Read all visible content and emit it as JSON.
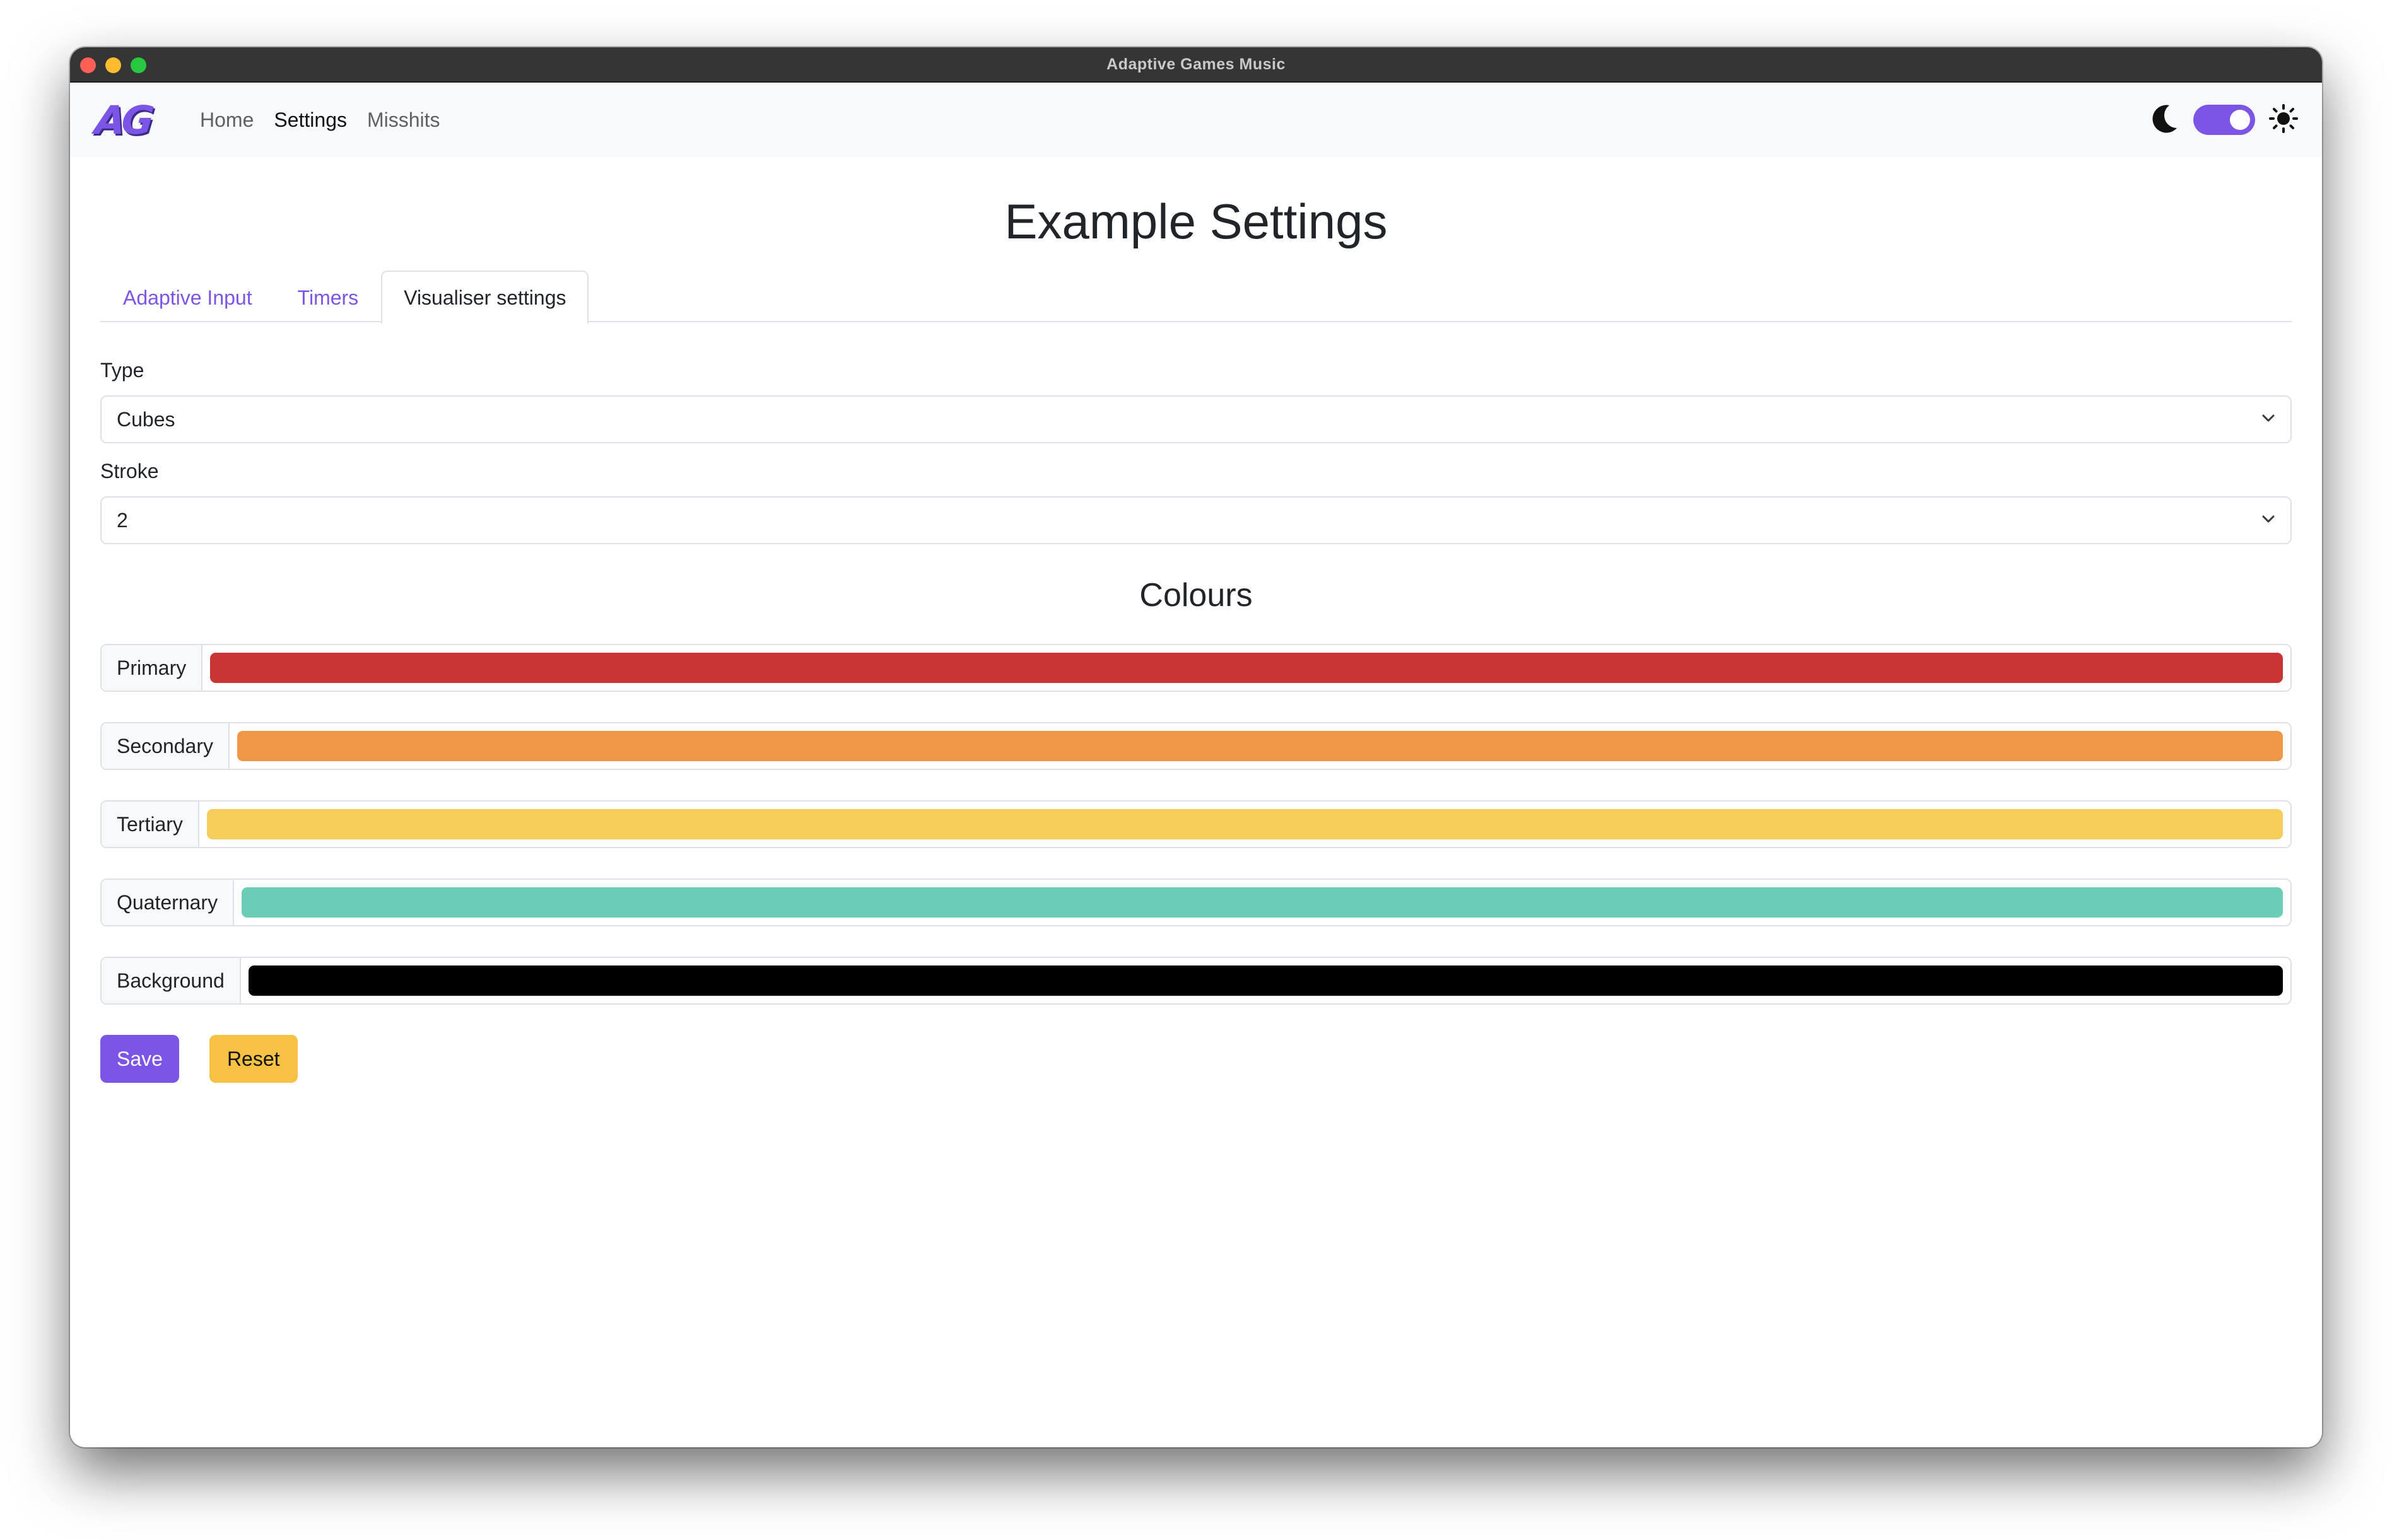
{
  "window": {
    "title": "Adaptive Games Music"
  },
  "navbar": {
    "logo_text": "AG",
    "links": [
      {
        "label": "Home",
        "active": false
      },
      {
        "label": "Settings",
        "active": true
      },
      {
        "label": "Misshits",
        "active": false
      }
    ],
    "theme_toggle": {
      "state": "on",
      "left_icon": "moon-icon",
      "right_icon": "sun-icon",
      "accent": "#7c55e6"
    }
  },
  "page": {
    "title": "Example Settings",
    "tabs": [
      {
        "label": "Adaptive Input",
        "active": false
      },
      {
        "label": "Timers",
        "active": false
      },
      {
        "label": "Visualiser settings",
        "active": true
      }
    ],
    "type": {
      "label": "Type",
      "value": "Cubes"
    },
    "stroke": {
      "label": "Stroke",
      "value": "2"
    },
    "colours": {
      "title": "Colours",
      "items": [
        {
          "label": "Primary",
          "color": "#c93535"
        },
        {
          "label": "Secondary",
          "color": "#ef9747"
        },
        {
          "label": "Tertiary",
          "color": "#f6cd5b"
        },
        {
          "label": "Quaternary",
          "color": "#6ccdb7"
        },
        {
          "label": "Background",
          "color": "#000000"
        }
      ]
    },
    "buttons": {
      "save": "Save",
      "reset": "Reset"
    }
  }
}
